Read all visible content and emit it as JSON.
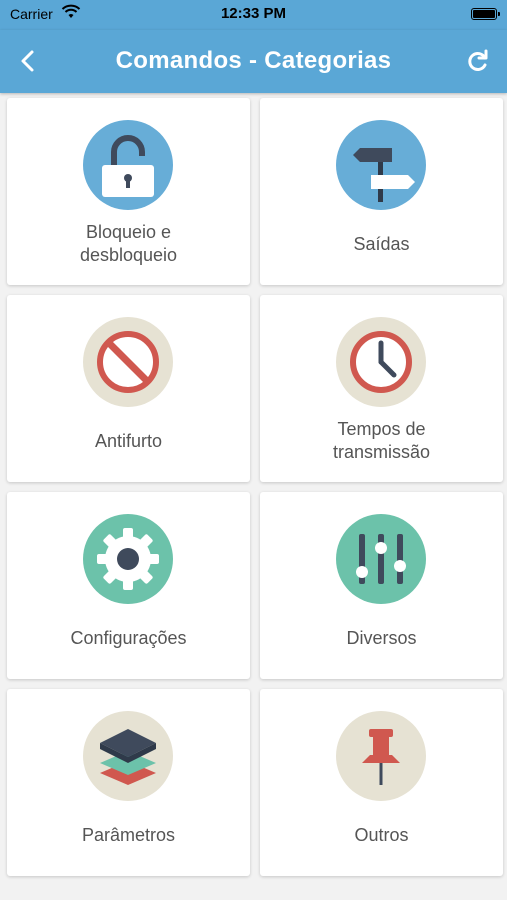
{
  "status_bar": {
    "carrier": "Carrier",
    "time": "12:33 PM"
  },
  "navbar": {
    "title": "Comandos - Categorias",
    "back_icon": "chevron-left-icon",
    "refresh_icon": "refresh-icon"
  },
  "categories": [
    {
      "label_line1": "Bloqueio e",
      "label_line2": "desbloqueio",
      "icon": "padlock-open-icon",
      "icon_bg": "#67add7"
    },
    {
      "label_line1": "Saídas",
      "label_line2": "",
      "icon": "signpost-icon",
      "icon_bg": "#67add7"
    },
    {
      "label_line1": "Antifurto",
      "label_line2": "",
      "icon": "prohibited-icon",
      "icon_bg": "#e6e2d3"
    },
    {
      "label_line1": "Tempos de",
      "label_line2": "transmissão",
      "icon": "clock-icon",
      "icon_bg": "#e6e2d3"
    },
    {
      "label_line1": "Configurações",
      "label_line2": "",
      "icon": "gear-icon",
      "icon_bg": "#6cc2aa"
    },
    {
      "label_line1": "Diversos",
      "label_line2": "",
      "icon": "sliders-icon",
      "icon_bg": "#6cc2aa"
    },
    {
      "label_line1": "Parâmetros",
      "label_line2": "",
      "icon": "layers-icon",
      "icon_bg": "#e6e2d3"
    },
    {
      "label_line1": "Outros",
      "label_line2": "",
      "icon": "pushpin-icon",
      "icon_bg": "#e6e2d3"
    }
  ]
}
